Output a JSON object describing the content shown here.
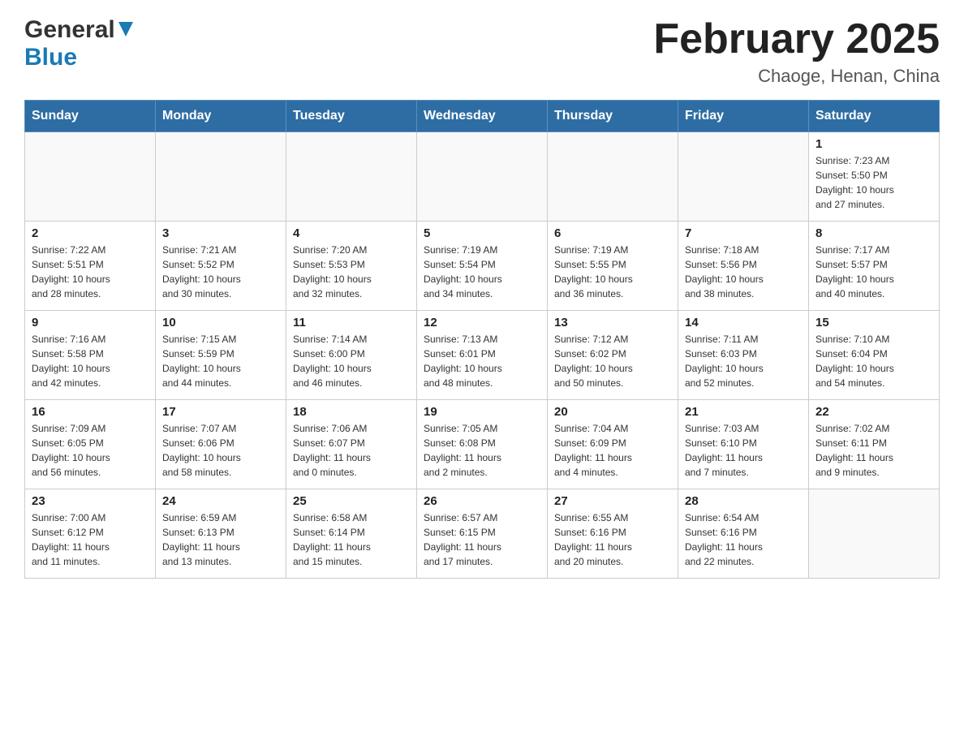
{
  "header": {
    "logo_general": "General",
    "logo_blue": "Blue",
    "title": "February 2025",
    "subtitle": "Chaoge, Henan, China"
  },
  "weekdays": [
    "Sunday",
    "Monday",
    "Tuesday",
    "Wednesday",
    "Thursday",
    "Friday",
    "Saturday"
  ],
  "weeks": [
    [
      {
        "day": "",
        "info": ""
      },
      {
        "day": "",
        "info": ""
      },
      {
        "day": "",
        "info": ""
      },
      {
        "day": "",
        "info": ""
      },
      {
        "day": "",
        "info": ""
      },
      {
        "day": "",
        "info": ""
      },
      {
        "day": "1",
        "info": "Sunrise: 7:23 AM\nSunset: 5:50 PM\nDaylight: 10 hours\nand 27 minutes."
      }
    ],
    [
      {
        "day": "2",
        "info": "Sunrise: 7:22 AM\nSunset: 5:51 PM\nDaylight: 10 hours\nand 28 minutes."
      },
      {
        "day": "3",
        "info": "Sunrise: 7:21 AM\nSunset: 5:52 PM\nDaylight: 10 hours\nand 30 minutes."
      },
      {
        "day": "4",
        "info": "Sunrise: 7:20 AM\nSunset: 5:53 PM\nDaylight: 10 hours\nand 32 minutes."
      },
      {
        "day": "5",
        "info": "Sunrise: 7:19 AM\nSunset: 5:54 PM\nDaylight: 10 hours\nand 34 minutes."
      },
      {
        "day": "6",
        "info": "Sunrise: 7:19 AM\nSunset: 5:55 PM\nDaylight: 10 hours\nand 36 minutes."
      },
      {
        "day": "7",
        "info": "Sunrise: 7:18 AM\nSunset: 5:56 PM\nDaylight: 10 hours\nand 38 minutes."
      },
      {
        "day": "8",
        "info": "Sunrise: 7:17 AM\nSunset: 5:57 PM\nDaylight: 10 hours\nand 40 minutes."
      }
    ],
    [
      {
        "day": "9",
        "info": "Sunrise: 7:16 AM\nSunset: 5:58 PM\nDaylight: 10 hours\nand 42 minutes."
      },
      {
        "day": "10",
        "info": "Sunrise: 7:15 AM\nSunset: 5:59 PM\nDaylight: 10 hours\nand 44 minutes."
      },
      {
        "day": "11",
        "info": "Sunrise: 7:14 AM\nSunset: 6:00 PM\nDaylight: 10 hours\nand 46 minutes."
      },
      {
        "day": "12",
        "info": "Sunrise: 7:13 AM\nSunset: 6:01 PM\nDaylight: 10 hours\nand 48 minutes."
      },
      {
        "day": "13",
        "info": "Sunrise: 7:12 AM\nSunset: 6:02 PM\nDaylight: 10 hours\nand 50 minutes."
      },
      {
        "day": "14",
        "info": "Sunrise: 7:11 AM\nSunset: 6:03 PM\nDaylight: 10 hours\nand 52 minutes."
      },
      {
        "day": "15",
        "info": "Sunrise: 7:10 AM\nSunset: 6:04 PM\nDaylight: 10 hours\nand 54 minutes."
      }
    ],
    [
      {
        "day": "16",
        "info": "Sunrise: 7:09 AM\nSunset: 6:05 PM\nDaylight: 10 hours\nand 56 minutes."
      },
      {
        "day": "17",
        "info": "Sunrise: 7:07 AM\nSunset: 6:06 PM\nDaylight: 10 hours\nand 58 minutes."
      },
      {
        "day": "18",
        "info": "Sunrise: 7:06 AM\nSunset: 6:07 PM\nDaylight: 11 hours\nand 0 minutes."
      },
      {
        "day": "19",
        "info": "Sunrise: 7:05 AM\nSunset: 6:08 PM\nDaylight: 11 hours\nand 2 minutes."
      },
      {
        "day": "20",
        "info": "Sunrise: 7:04 AM\nSunset: 6:09 PM\nDaylight: 11 hours\nand 4 minutes."
      },
      {
        "day": "21",
        "info": "Sunrise: 7:03 AM\nSunset: 6:10 PM\nDaylight: 11 hours\nand 7 minutes."
      },
      {
        "day": "22",
        "info": "Sunrise: 7:02 AM\nSunset: 6:11 PM\nDaylight: 11 hours\nand 9 minutes."
      }
    ],
    [
      {
        "day": "23",
        "info": "Sunrise: 7:00 AM\nSunset: 6:12 PM\nDaylight: 11 hours\nand 11 minutes."
      },
      {
        "day": "24",
        "info": "Sunrise: 6:59 AM\nSunset: 6:13 PM\nDaylight: 11 hours\nand 13 minutes."
      },
      {
        "day": "25",
        "info": "Sunrise: 6:58 AM\nSunset: 6:14 PM\nDaylight: 11 hours\nand 15 minutes."
      },
      {
        "day": "26",
        "info": "Sunrise: 6:57 AM\nSunset: 6:15 PM\nDaylight: 11 hours\nand 17 minutes."
      },
      {
        "day": "27",
        "info": "Sunrise: 6:55 AM\nSunset: 6:16 PM\nDaylight: 11 hours\nand 20 minutes."
      },
      {
        "day": "28",
        "info": "Sunrise: 6:54 AM\nSunset: 6:16 PM\nDaylight: 11 hours\nand 22 minutes."
      },
      {
        "day": "",
        "info": ""
      }
    ]
  ]
}
